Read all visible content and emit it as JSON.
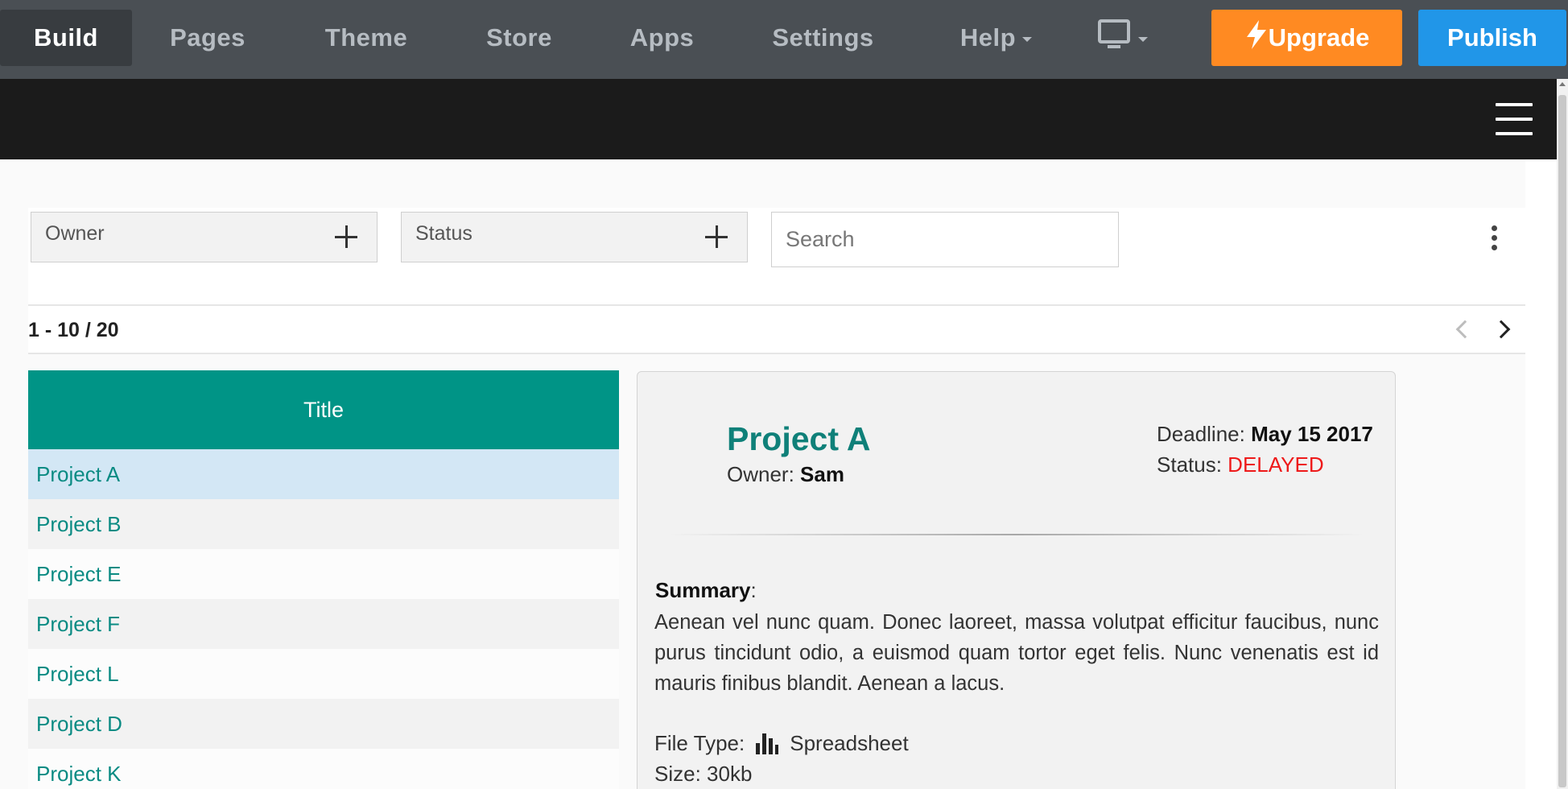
{
  "toolbar": {
    "nav": [
      "Build",
      "Pages",
      "Theme",
      "Store",
      "Apps",
      "Settings",
      "Help"
    ],
    "upgrade_label": "Upgrade",
    "publish_label": "Publish",
    "colors": {
      "bar": "#4a4f54",
      "upgrade": "#ff8a22",
      "publish": "#2196e8"
    }
  },
  "filters": {
    "owner_label": "Owner",
    "status_label": "Status",
    "search_placeholder": "Search"
  },
  "pagination": {
    "range_text": "1 - 10 / 20"
  },
  "list": {
    "header": "Title",
    "items": [
      "Project A",
      "Project B",
      "Project E",
      "Project F",
      "Project L",
      "Project D",
      "Project K"
    ]
  },
  "detail": {
    "title": "Project A",
    "owner_label": "Owner:",
    "owner_value": "Sam",
    "deadline_label": "Deadline:",
    "deadline_value": "May 15 2017",
    "status_label": "Status:",
    "status_value": "DELAYED",
    "summary_label": "Summary",
    "summary_text": "Aenean vel nunc quam. Donec laoreet, massa volutpat efficitur faucibus, nunc purus tincidunt odio, a euismod quam tortor eget felis. Nunc venenatis est id mauris finibus blandit. Aenean a lacus.",
    "filetype_label": "File Type:",
    "filetype_value": "Spreadsheet",
    "filetype_icon": "bar-chart-icon",
    "size_label": "Size:",
    "size_value": "30kb"
  }
}
